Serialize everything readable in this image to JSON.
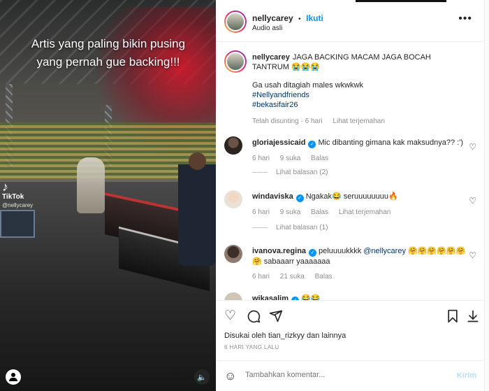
{
  "media": {
    "overlay_text": "Artis yang paling bikin pusing yang pernah gue backing!!!",
    "watermark_brand": "TikTok",
    "watermark_handle": "@nellycarey",
    "sound_icon": "speaker-icon"
  },
  "header": {
    "username": "nellycarey",
    "separator": "•",
    "follow_label": "Ikuti",
    "audio_label": "Audio asli",
    "more_icon": "more-icon"
  },
  "caption": {
    "username": "nellycarey",
    "text": "JAGA BACKING MACAM JAGA BOCAH TANTRUM 😭😭😭",
    "line2": "Ga usah ditagiah males wkwkwk",
    "hashtag1": "#Nellyandfriends",
    "hashtag2": "#bekasifair26",
    "edited": "Telah disunting · 6 hari",
    "translate": "Lihat terjemahan"
  },
  "comments": [
    {
      "username": "gloriajessicaid",
      "verified": true,
      "text": "Mic dibanting gimana kak maksudnya?? :')",
      "age": "6 hari",
      "likes": "9 suka",
      "reply": "Balas",
      "translate": "",
      "view_replies": "Lihat balasan (2)"
    },
    {
      "username": "windaviska",
      "verified": true,
      "text": "Ngakak😂 seruuuuuuuu🔥",
      "age": "6 hari",
      "likes": "9 suka",
      "reply": "Balas",
      "translate": "Lihat terjemahan",
      "view_replies": "Lihat balasan (1)"
    },
    {
      "username": "ivanova.regina",
      "verified": true,
      "mention": "@nellycarey",
      "text_before": "peluuuukkkk",
      "text_after": "🤗🤗🤗🤗🤗🤗🤗 sabaaarr yaaaaaaa",
      "age": "6 hari",
      "likes": "21 suka",
      "reply": "Balas"
    },
    {
      "username": "wikasalim",
      "verified": true,
      "text": "😂😂"
    }
  ],
  "actions": {
    "likes_text": "Disukai oleh tian_rizkyy dan lainnya",
    "date": "6 HARI YANG LALU"
  },
  "composer": {
    "placeholder": "Tambahkan komentar...",
    "send_label": "Kirim"
  }
}
